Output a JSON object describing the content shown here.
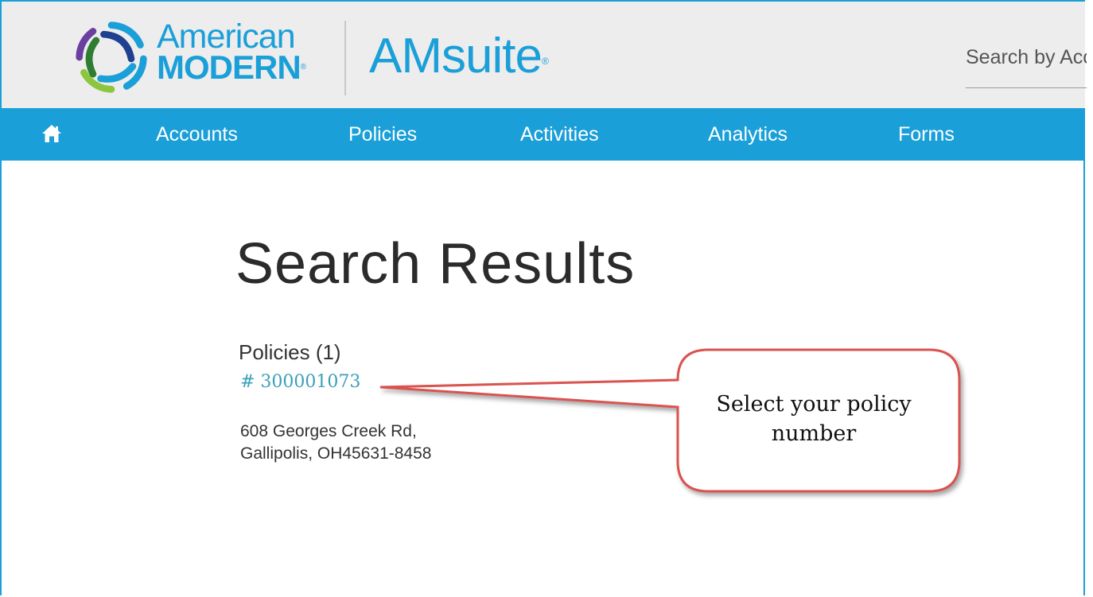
{
  "header": {
    "brand_line1": "American",
    "brand_line2": "MODERN",
    "brand_mark": "®",
    "app_name": "AMsuite",
    "app_mark": "®",
    "search_placeholder": "Search by Account"
  },
  "nav": {
    "home_icon": "home-icon",
    "items": [
      "Accounts",
      "Policies",
      "Activities",
      "Analytics",
      "Forms"
    ]
  },
  "main": {
    "title": "Search Results",
    "policies_heading": "Policies (1)",
    "policy_number": "# 300001073",
    "address_line1": "608 Georges Creek Rd,",
    "address_line2": "Gallipolis, OH45631-8458"
  },
  "callout": {
    "text": "Select your policy number"
  },
  "colors": {
    "accent": "#1a9fd8",
    "header_bg": "#ededed",
    "link": "#3aa0b8",
    "callout_border": "#d9534f"
  }
}
